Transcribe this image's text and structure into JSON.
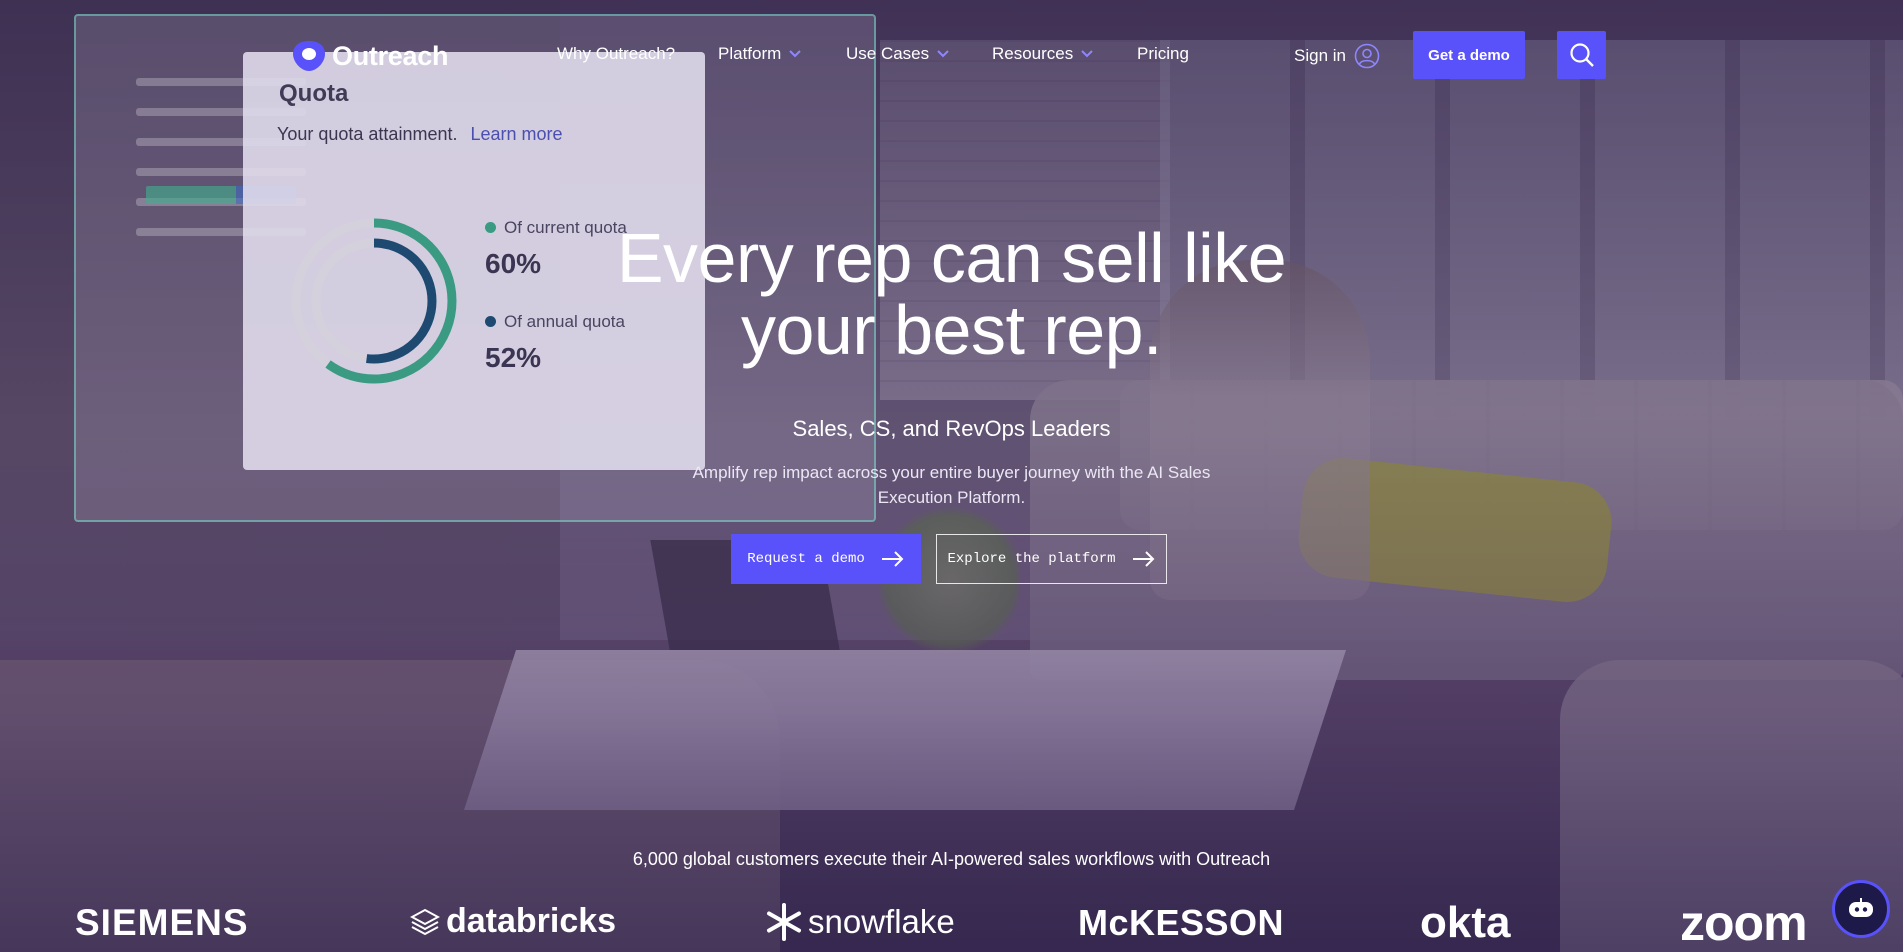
{
  "brand": {
    "name": "Outreach",
    "accent": "#5951fa"
  },
  "nav": {
    "items": [
      {
        "label": "Why Outreach?",
        "has_dropdown": false
      },
      {
        "label": "Platform",
        "has_dropdown": true
      },
      {
        "label": "Use Cases",
        "has_dropdown": true
      },
      {
        "label": "Resources",
        "has_dropdown": true
      },
      {
        "label": "Pricing",
        "has_dropdown": false
      }
    ],
    "sign_in": "Sign in",
    "get_demo": "Get a demo",
    "search_icon": "search-icon"
  },
  "dashboard": {
    "title": "Quota",
    "subtitle": "Your quota attainment.",
    "link": "Learn more",
    "legend": [
      {
        "label": "Of current quota",
        "value": "60%",
        "fraction": 0.6,
        "color": "#3a9a82"
      },
      {
        "label": "Of annual quota",
        "value": "52%",
        "fraction": 0.52,
        "color": "#1e4a72"
      }
    ]
  },
  "hero": {
    "title_line1": "Every rep can sell like",
    "title_line2": "your best rep.",
    "subtitle": "Sales, CS, and RevOps Leaders",
    "description": "Amplify rep impact across your entire buyer journey with the AI Sales Execution Platform.",
    "cta_primary": "Request a demo",
    "cta_secondary": "Explore the platform"
  },
  "customers": {
    "headline": "6,000 global customers execute their AI-powered sales workflows with Outreach",
    "logos": [
      "SIEMENS",
      "databricks",
      "snowflake",
      "McKESSON",
      "okta",
      "zoom"
    ]
  },
  "chat": {
    "icon": "chatbot-icon"
  }
}
